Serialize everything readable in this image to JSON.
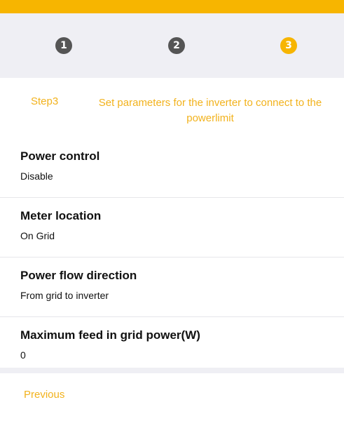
{
  "colors": {
    "accent": "#f7b500",
    "accent_text": "#f2b21c",
    "step_inactive": "#555555",
    "band": "#efeff4"
  },
  "steps": [
    {
      "number": "1",
      "state": "inactive"
    },
    {
      "number": "2",
      "state": "inactive"
    },
    {
      "number": "3",
      "state": "active"
    }
  ],
  "caption": {
    "step_label": "Step3",
    "description": "Set parameters for the inverter to connect to the powerlimit"
  },
  "params": [
    {
      "title": "Power control",
      "value": "Disable"
    },
    {
      "title": "Meter location",
      "value": "On Grid"
    },
    {
      "title": "Power flow direction",
      "value": "From grid to inverter"
    },
    {
      "title": "Maximum feed in grid power(W)",
      "value": "0"
    }
  ],
  "footer": {
    "previous_label": "Previous"
  }
}
